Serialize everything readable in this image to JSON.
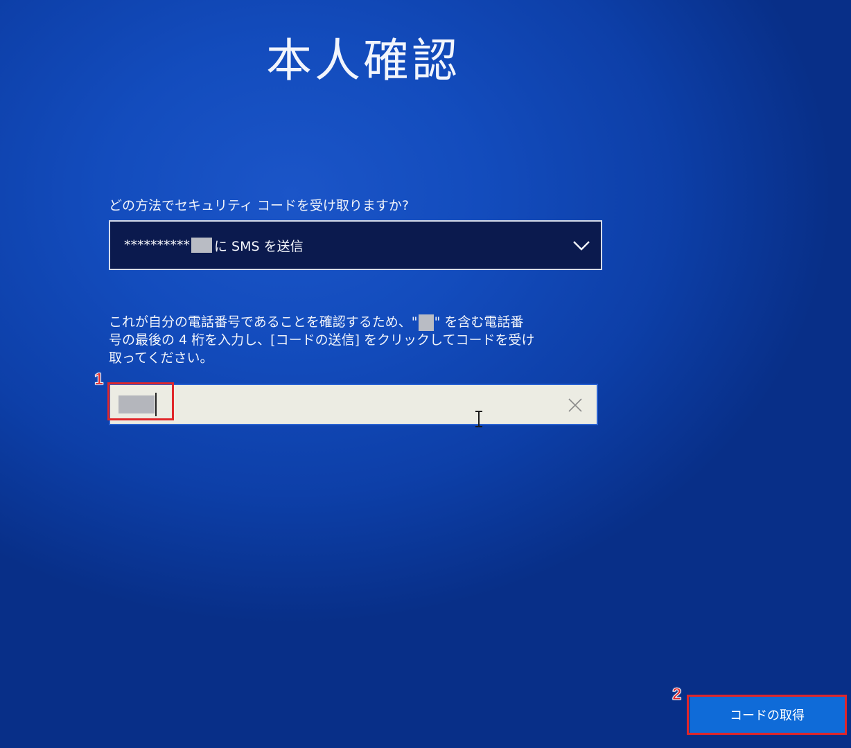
{
  "header": {
    "title": "本人確認"
  },
  "security_code": {
    "question": "どの方法でセキュリティ コードを受け取りますか?",
    "method_select": {
      "selected_prefix": "**********",
      "selected_suffix": "に SMS を送信",
      "icon": "chevron-down-icon"
    },
    "instruction_lines": {
      "line1_before": "これが自分の電話番号であることを確認するため、\"",
      "line1_after": "\" を含む電話番",
      "line2": "号の最後の 4 桁を入力し、[コードの送信] をクリックしてコードを受け",
      "line3": "取ってください。"
    },
    "phone_digits_input": {
      "value": "",
      "clear_icon": "close-icon"
    }
  },
  "footer": {
    "get_code_label": "コードの取得"
  },
  "annotations": {
    "step1": "1",
    "step2": "2",
    "highlight_color": "#e0262a"
  },
  "colors": {
    "background": "#134cbd",
    "select_background": "#0b1a4e",
    "input_background": "#ecece3",
    "button_background": "#0f6bd8"
  }
}
